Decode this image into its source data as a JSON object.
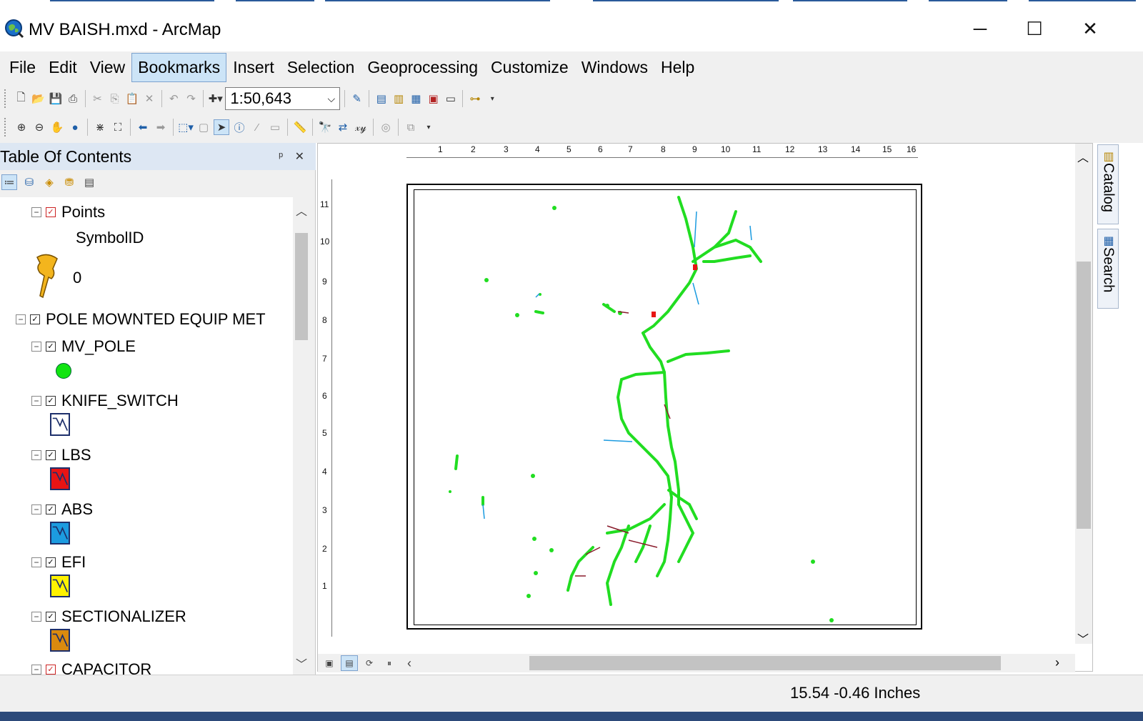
{
  "window": {
    "title": "MV BAISH.mxd - ArcMap",
    "controls": {
      "minimize": "─",
      "maximize": "☐",
      "close": "✕"
    }
  },
  "menu": [
    "File",
    "Edit",
    "View",
    "Bookmarks",
    "Insert",
    "Selection",
    "Geoprocessing",
    "Customize",
    "Windows",
    "Help"
  ],
  "menu_active": "Bookmarks",
  "standard_toolbar": {
    "scale": "1:50,643"
  },
  "toc": {
    "title": "Table Of Contents",
    "pin": "ᵖ",
    "close": "✕",
    "layers": {
      "points": {
        "name": "Points",
        "field": "SymbolID",
        "value": "0"
      },
      "group": {
        "name": "POLE MOWNTED EQUIP MET"
      },
      "mv_pole": "MV_POLE",
      "knife_switch": "KNIFE_SWITCH",
      "lbs": "LBS",
      "abs": "ABS",
      "efi": "EFI",
      "sectionalizer": "SECTIONALIZER",
      "capacitor": "CAPACITOR"
    }
  },
  "symbol_colors": {
    "mv_pole": "#11e411",
    "knife_switch": "#ffffff",
    "lbs": "#e81414",
    "abs": "#1c9be0",
    "efi": "#fff200",
    "sectionalizer": "#db8a0e"
  },
  "ruler": {
    "horizontal": [
      "1",
      "2",
      "3",
      "4",
      "5",
      "6",
      "7",
      "8",
      "9",
      "10",
      "11",
      "12",
      "13",
      "14",
      "15",
      "16"
    ],
    "vertical": [
      "11",
      "10",
      "9",
      "8",
      "7",
      "6",
      "5",
      "4",
      "3",
      "2",
      "1"
    ]
  },
  "dock": {
    "catalog": "Catalog",
    "search": "Search"
  },
  "status": {
    "coordinates": "15.54  -0.46 Inches"
  }
}
